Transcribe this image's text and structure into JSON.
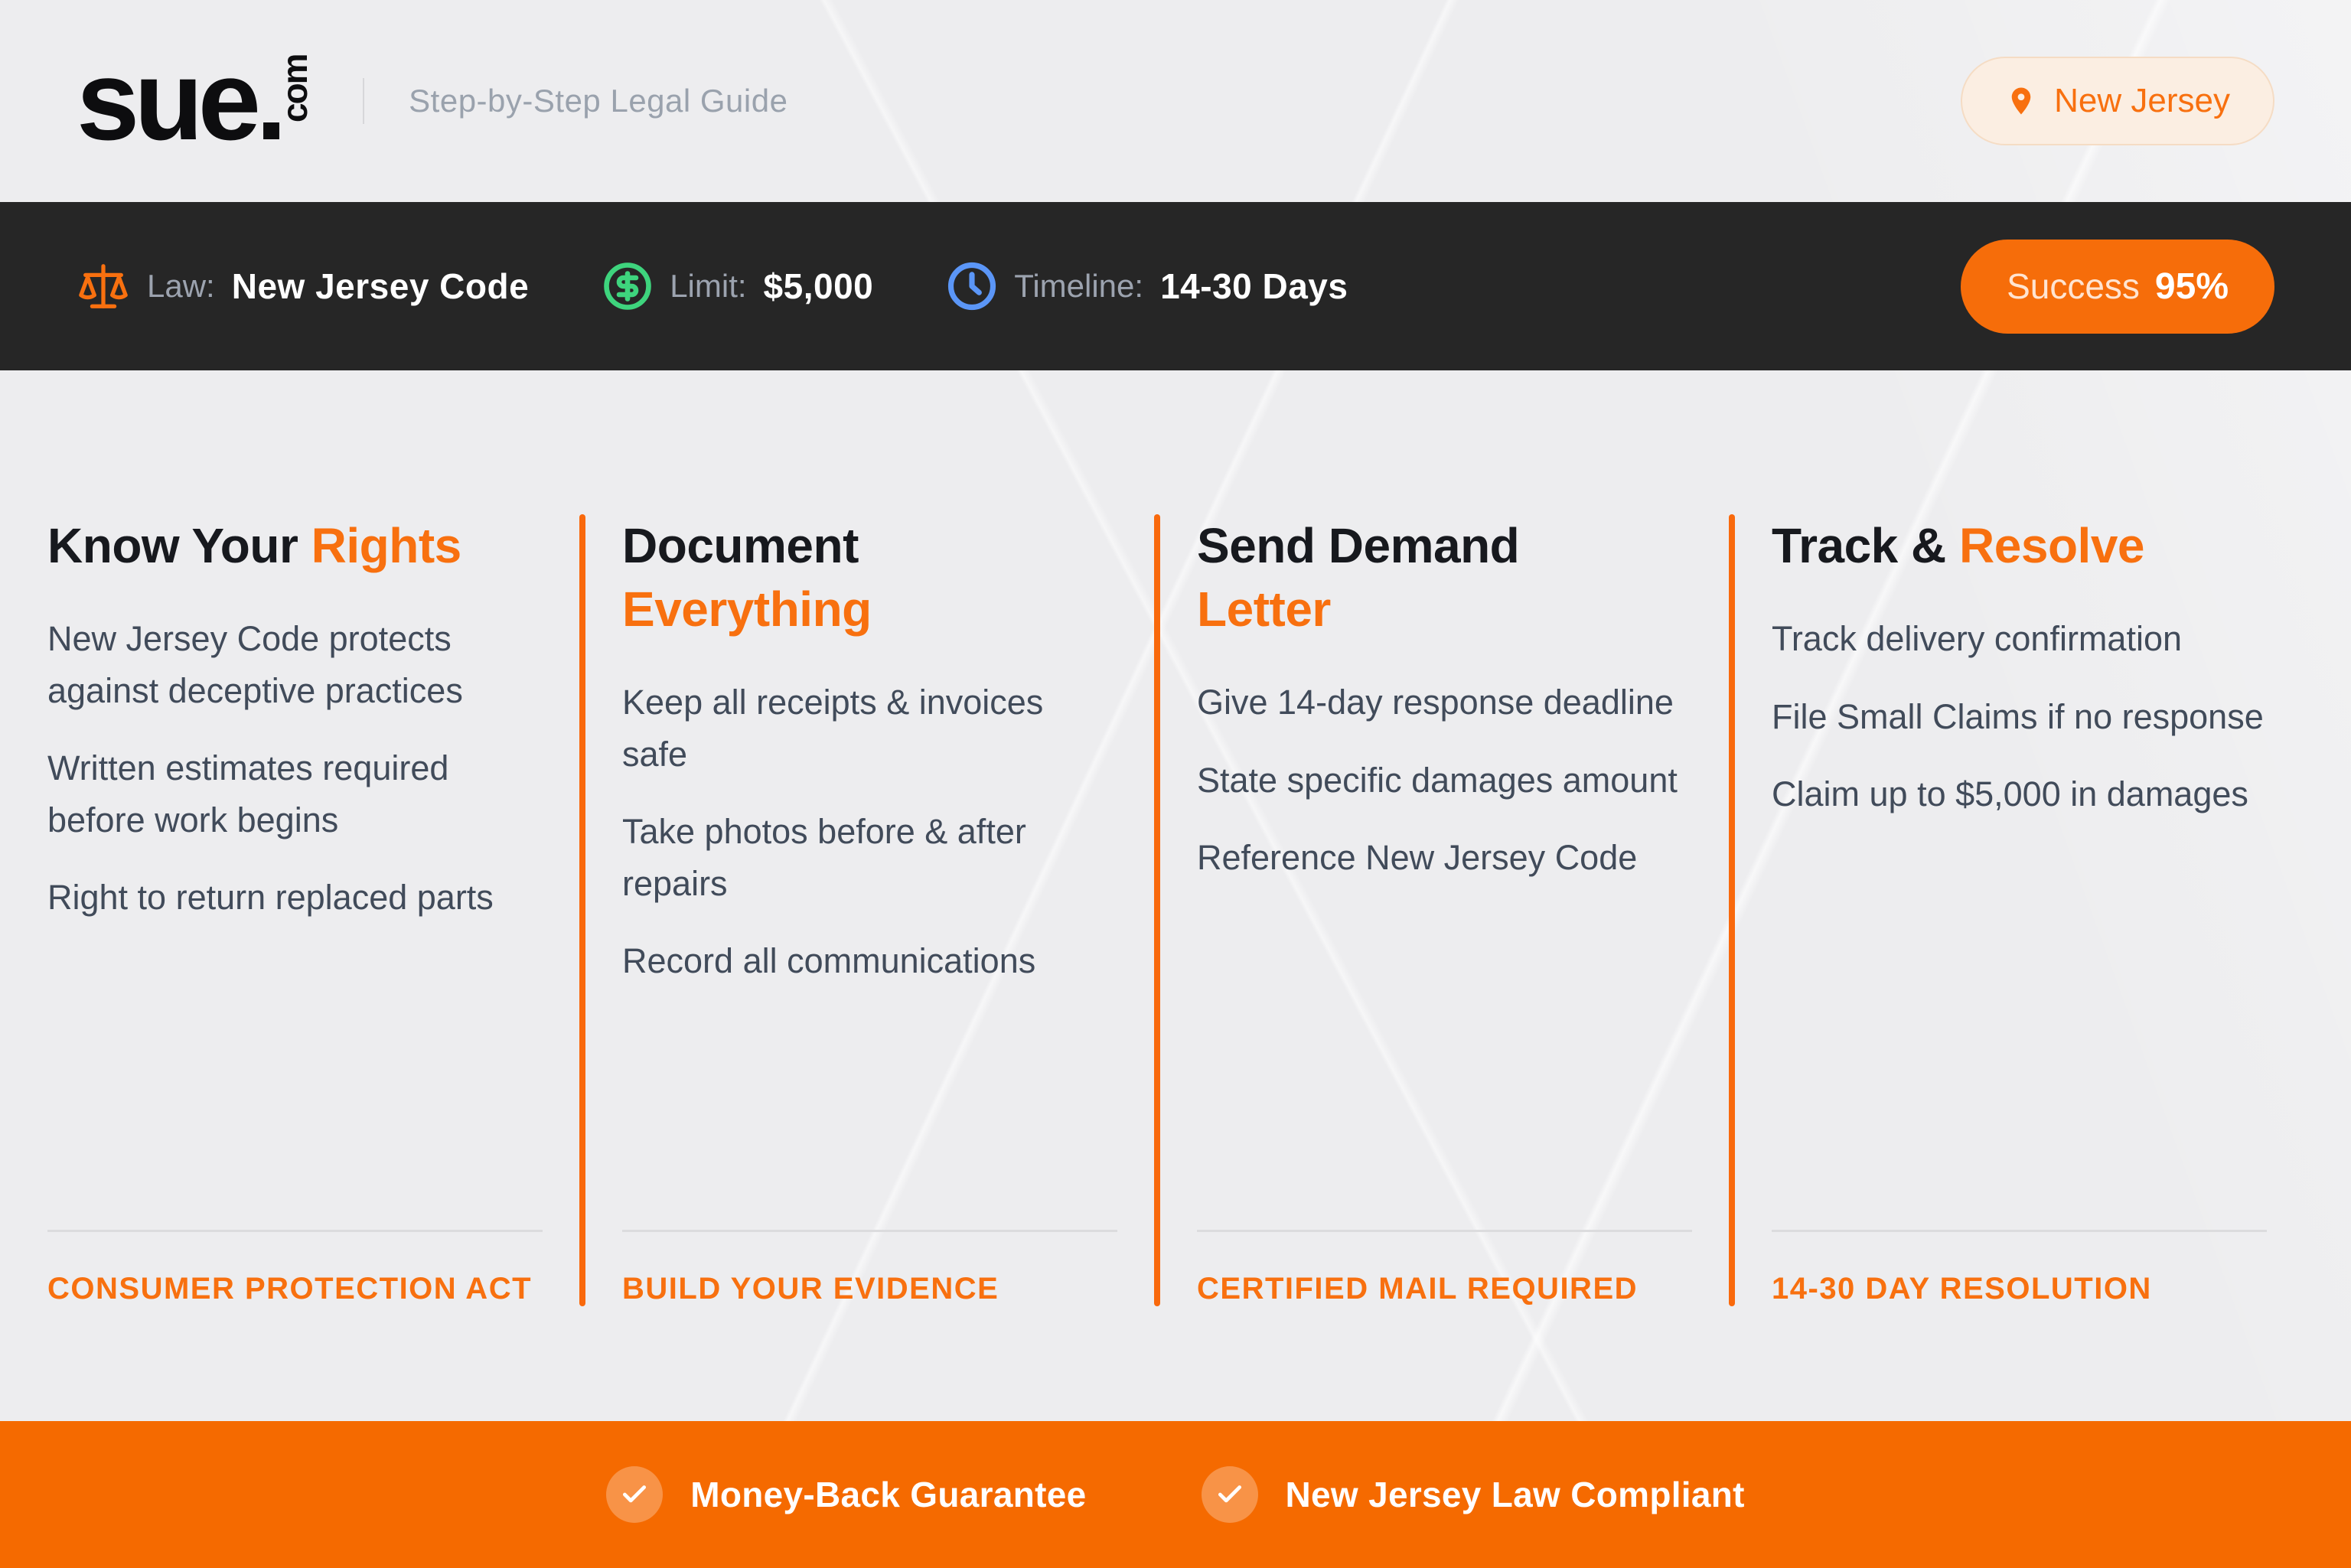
{
  "header": {
    "logo_text": "sue.",
    "logo_suffix": "com",
    "tagline": "Step-by-Step Legal Guide",
    "location_badge": "New Jersey"
  },
  "info_bar": {
    "stats": [
      {
        "icon": "scales-icon",
        "label": "Law:",
        "value": "New Jersey Code"
      },
      {
        "icon": "dollar-icon",
        "label": "Limit:",
        "value": "$5,000"
      },
      {
        "icon": "clock-icon",
        "label": "Timeline:",
        "value": "14-30 Days"
      }
    ],
    "success_label": "Success",
    "success_value": "95%"
  },
  "main": {
    "columns": [
      {
        "title_dark": "Know Your",
        "title_accent": "Rights",
        "accent_on_new_line": false,
        "items": [
          "New Jersey Code protects against deceptive practices",
          "Written estimates required before work begins",
          "Right to return replaced parts"
        ],
        "footer_label": "CONSUMER PROTECTION ACT"
      },
      {
        "title_dark": "Document",
        "title_accent": "Everything",
        "accent_on_new_line": true,
        "items": [
          "Keep all receipts & invoices safe",
          "Take photos before & after repairs",
          "Record all communications"
        ],
        "footer_label": "BUILD YOUR EVIDENCE"
      },
      {
        "title_dark": "Send Demand",
        "title_accent": "Letter",
        "accent_on_new_line": true,
        "items": [
          "Give 14-day response deadline",
          "State specific damages amount",
          "Reference New Jersey Code"
        ],
        "footer_label": "CERTIFIED MAIL REQUIRED"
      },
      {
        "title_dark": "Track &",
        "title_accent": "Resolve",
        "accent_on_new_line": false,
        "items": [
          "Track delivery confirmation",
          "File Small Claims if no response",
          "Claim up to $5,000 in damages"
        ],
        "footer_label": "14-30 DAY RESOLUTION"
      }
    ]
  },
  "footer": {
    "items": [
      {
        "icon": "check-icon",
        "label": "Money-Back Guarantee"
      },
      {
        "icon": "check-icon",
        "label": "New Jersey Law Compliant"
      }
    ]
  },
  "colors": {
    "accent": "#f8700f",
    "footer_bg": "#f56a00",
    "dark_bar": "#262626",
    "green": "#3ed47d",
    "blue": "#5b96f7"
  }
}
